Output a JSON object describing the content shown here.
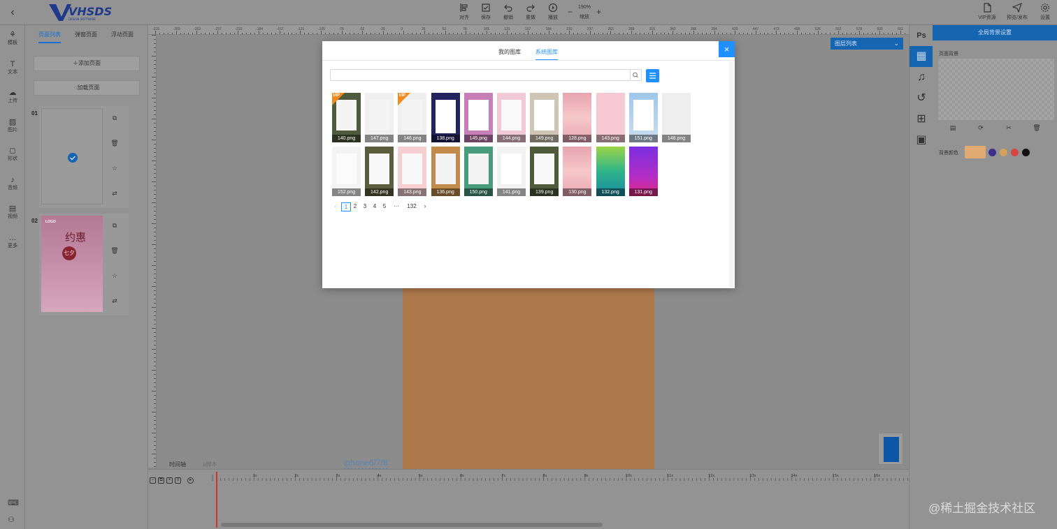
{
  "app": {
    "logo_text": "VHSDS",
    "logo_sub": "DESIGN SOFTWARE"
  },
  "toolbar": {
    "align": "对齐",
    "save": "保存",
    "undo": "撤销",
    "redo": "重做",
    "play": "播放",
    "zoom_value": "190%",
    "zoom_label": "缩放",
    "zoom_minus": "−",
    "zoom_plus": "+",
    "vip": "VIP资源",
    "preview": "预览/发布",
    "settings": "设置"
  },
  "rail": [
    "模板",
    "文本",
    "上传",
    "图片",
    "形状",
    "音频",
    "视频",
    "更多"
  ],
  "page_panel": {
    "tabs": [
      "页面列表",
      "弹窗页面",
      "浮动页面"
    ],
    "add_page": "添加页面",
    "load_page": "加载页面",
    "pages": [
      {
        "num": "01"
      },
      {
        "num": "02",
        "thumb_text": "约惠",
        "thumb_text2": "七夕",
        "logo": "LOGO"
      }
    ]
  },
  "ruler_labels": [
    "-315",
    "-289",
    "-263",
    "-237",
    "-210",
    "-184",
    "-157",
    "-131",
    "-105",
    "-78",
    "-52",
    "-26",
    "0",
    "26",
    "52",
    "78",
    "105",
    "131",
    "157",
    "184",
    "210",
    "237",
    "263",
    "289",
    "315",
    "342",
    "368",
    "394",
    "420",
    "447",
    "473",
    "499",
    "526",
    "552",
    "578",
    "605",
    "631"
  ],
  "canvas": {
    "device_label": "iphone6/7/8",
    "layer_dropdown": "图层列表",
    "bg_color": "#ae7a4c"
  },
  "timeline": {
    "tabs": [
      "时间轴",
      "a脚本"
    ],
    "marks": [
      "1s",
      "2s",
      "3s",
      "4s",
      "5s",
      "6s",
      "7s",
      "8s",
      "9s",
      "10s",
      "11s",
      "12s",
      "13s",
      "14s",
      "15s",
      "16s"
    ]
  },
  "right_panel": {
    "header": "全局背景设置",
    "page_bg_label": "页面背景",
    "bg_color_label": "背景颜色",
    "swatch_color": "#e0aa72",
    "dots": [
      "#3d2f8a",
      "#d4a15c",
      "#d84545",
      "#111111"
    ]
  },
  "modal": {
    "tabs": [
      "我的图库",
      "系统图库"
    ],
    "active_tab": 1,
    "close": "×",
    "search_value": "",
    "images": [
      {
        "name": "140.png",
        "bg": "#4d5a3b",
        "frame": "#f4f4f4",
        "vip": true
      },
      {
        "name": "147.png",
        "bg": "#f0f0f0",
        "frame": "#f4f4f4",
        "vip": false
      },
      {
        "name": "146.png",
        "bg": "#efefef",
        "frame": "#f4f4f4",
        "vip": true
      },
      {
        "name": "138.png",
        "bg": "#23245e",
        "frame": "#ffffff",
        "vip": false
      },
      {
        "name": "145.png",
        "bg": "#c87fb8",
        "frame": "#ffffff",
        "vip": false
      },
      {
        "name": "144.png",
        "bg": "#f2c9d6",
        "frame": "#fafafa",
        "vip": false
      },
      {
        "name": "149.png",
        "bg": "#d0c5b4",
        "frame": "#ffffff",
        "vip": false
      },
      {
        "name": "128.png",
        "bg": "#e69aa8",
        "frame": "",
        "vip": false
      },
      {
        "name": "143.png",
        "bg": "#f7c9d4",
        "frame": "",
        "vip": false
      },
      {
        "name": "151.png",
        "bg": "#9fc6ea",
        "frame": "#ffffff",
        "vip": false
      },
      {
        "name": "148.png",
        "bg": "#eeeeee",
        "frame": "",
        "vip": false
      },
      {
        "name": "152.png",
        "bg": "#f3f3f3",
        "frame": "#fbfbfb",
        "vip": false
      },
      {
        "name": "142.png",
        "bg": "#5b5e3c",
        "frame": "#f8f8f8",
        "vip": false
      },
      {
        "name": "143.png",
        "bg": "#f6cfd2",
        "frame": "#f8f8f8",
        "vip": false
      },
      {
        "name": "136.png",
        "bg": "#c28b4c",
        "frame": "#f4f4f4",
        "vip": false
      },
      {
        "name": "150.png",
        "bg": "#4a9a7e",
        "frame": "#f4f4f4",
        "vip": false
      },
      {
        "name": "141.png",
        "bg": "#f2f2f2",
        "frame": "#ffffff",
        "vip": false
      },
      {
        "name": "139.png",
        "bg": "#4f5a3a",
        "frame": "#f8f8f8",
        "vip": false
      },
      {
        "name": "130.png",
        "bg": "#f0a6ae",
        "frame": "",
        "vip": false
      },
      {
        "name": "132.png",
        "bg": "#2fb48a",
        "frame": "",
        "vip": false
      },
      {
        "name": "131.png",
        "bg": "#8c2bd9",
        "frame": "",
        "vip": false
      }
    ],
    "pager": {
      "prev": "‹",
      "pages": [
        "1",
        "2",
        "3",
        "4",
        "5"
      ],
      "ellipsis": "···",
      "last": "132",
      "next": "›",
      "current": "1"
    }
  },
  "watermark": "@稀土掘金技术社区"
}
